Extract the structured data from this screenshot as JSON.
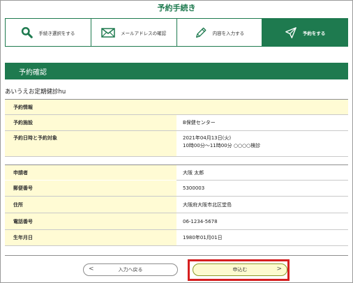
{
  "header": {
    "title": "予約手続き"
  },
  "steps": [
    {
      "label": "手続き選択をする",
      "icon": "search-icon"
    },
    {
      "label": "メールアドレスの確認",
      "icon": "mail-icon"
    },
    {
      "label": "内容を入力する",
      "icon": "pencil-icon"
    },
    {
      "label": "予約をする",
      "icon": "send-icon",
      "active": true
    }
  ],
  "section": {
    "title": "予約確認"
  },
  "exam_name": "あいうえお定期健診hu",
  "reservation": {
    "heading": "予約情報",
    "facility_label": "予約施設",
    "facility_value": "B保健センター",
    "datetime_label": "予約日時と予約対象",
    "date_value": "2021年04月13日(火)",
    "time_value": "10時00分～11時00分 ○○○○検診"
  },
  "applicant": {
    "name_label": "申請者",
    "name_value": "大阪 太郎",
    "postal_label": "郵便番号",
    "postal_value": "5300003",
    "address_label": "住所",
    "address_value": "大阪府大阪市北区堂島",
    "phone_label": "電話番号",
    "phone_value": "06-1234-5678",
    "birth_label": "生年月日",
    "birth_value": "1980年01月01日"
  },
  "buttons": {
    "back_label": "入力へ戻る",
    "back_arrow": "<",
    "submit_label": "申込む",
    "submit_arrow": ">"
  },
  "colors": {
    "accent": "#1e7a4f",
    "header_cell": "#fffbd4",
    "button_submit": "#fdfbcf",
    "highlight": "#d61f1f"
  }
}
